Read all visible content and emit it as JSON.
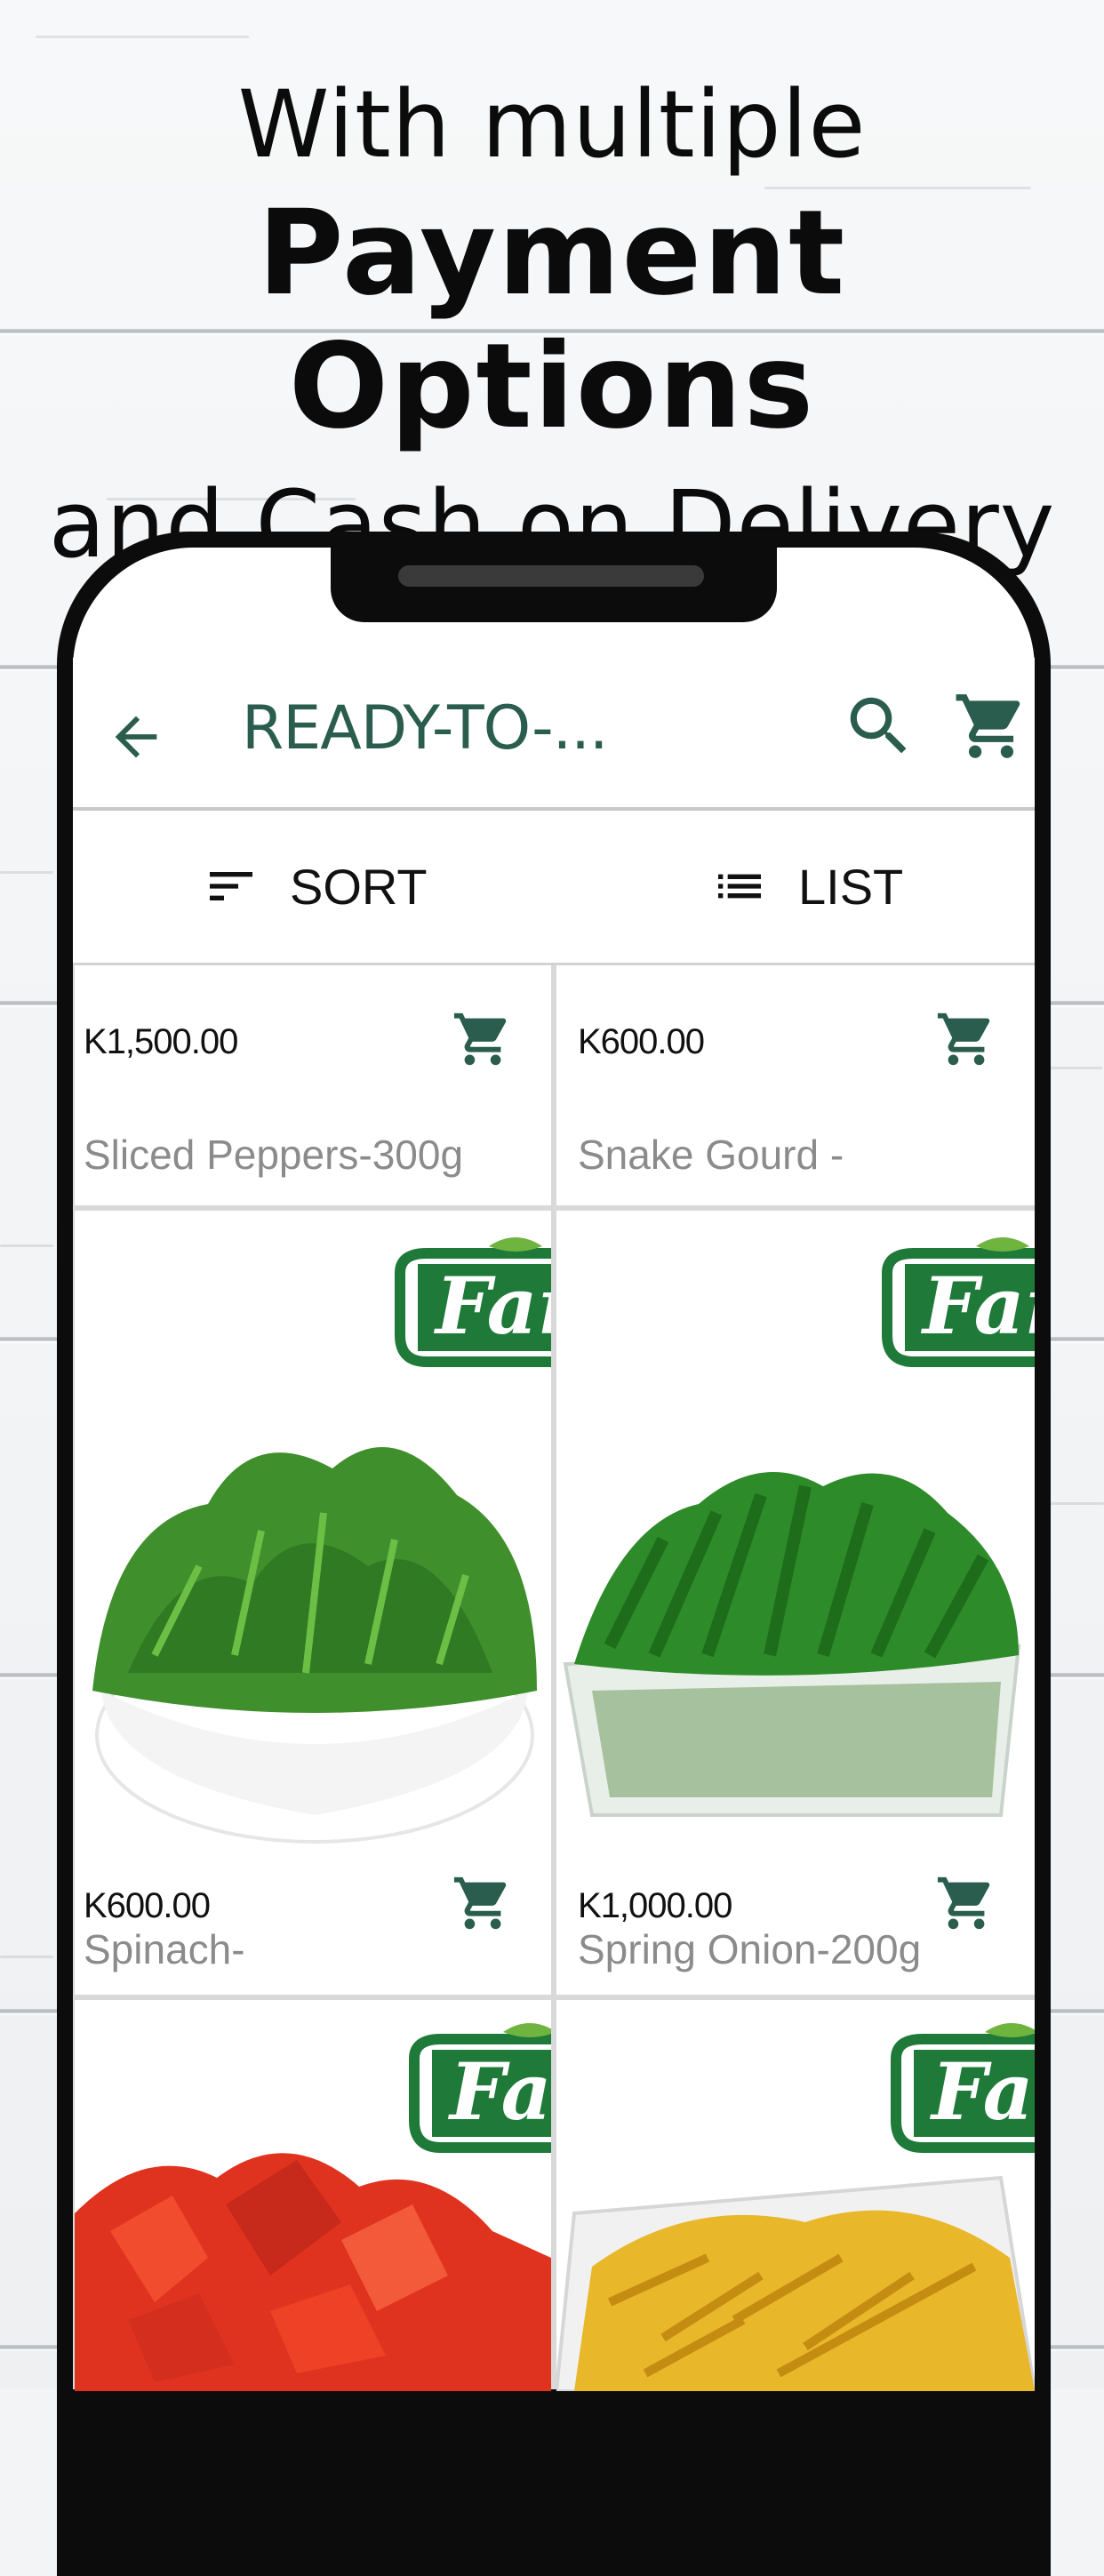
{
  "headline": {
    "line1": "With multiple",
    "line2": "Payment Options",
    "line3": "and Cash on Delivery"
  },
  "appbar": {
    "title": "READY-TO-...",
    "back_icon": "arrow-left-icon",
    "search_icon": "search-icon",
    "cart_icon": "cart-icon"
  },
  "toolbar": {
    "sort_label": "SORT",
    "list_label": "LIST"
  },
  "products": [
    {
      "price": "K1,500.00",
      "name": "Sliced Peppers-300g"
    },
    {
      "price": "K600.00",
      "name": "Snake Gourd -"
    },
    {
      "price": "K600.00",
      "name": "Spinach-"
    },
    {
      "price": "K1,000.00",
      "name": "Spring Onion-200g"
    },
    {
      "price": "",
      "name": ""
    },
    {
      "price": "",
      "name": ""
    }
  ],
  "colors": {
    "brand": "#2a5d4d",
    "accent_green": "#1f7a3a"
  }
}
